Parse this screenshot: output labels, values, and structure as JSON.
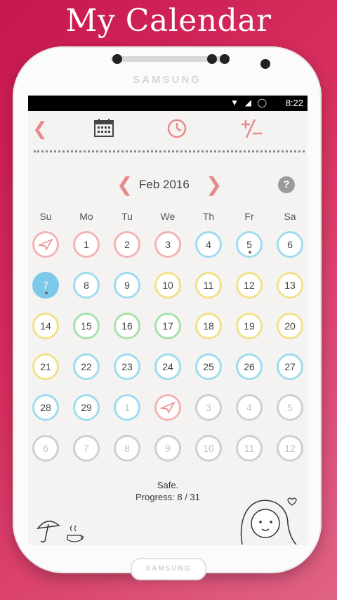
{
  "promo": {
    "title": "My Calendar"
  },
  "device": {
    "brand_top": "SAMSUNG",
    "brand_bottom": "SAMSUNG"
  },
  "status_bar": {
    "time": "8:22"
  },
  "toolbar": {
    "back_icon": "chevron-left-icon",
    "calendar_icon": "calendar-icon",
    "clock_icon": "clock-icon",
    "plusminus_icon": "plus-minus-icon"
  },
  "calendar": {
    "month_label": "Feb 2016",
    "help_label": "?",
    "weekdays": [
      "Su",
      "Mo",
      "Tu",
      "We",
      "Th",
      "Fr",
      "Sa"
    ],
    "rows": [
      [
        {
          "l": "",
          "c": "pink",
          "icon": "plane"
        },
        {
          "l": "1",
          "c": "pink"
        },
        {
          "l": "2",
          "c": "pink"
        },
        {
          "l": "3",
          "c": "pink"
        },
        {
          "l": "4",
          "c": "blue"
        },
        {
          "l": "5",
          "c": "blue",
          "dot": true
        },
        {
          "l": "6",
          "c": "blue"
        }
      ],
      [
        {
          "l": "7",
          "c": "today",
          "dot": true
        },
        {
          "l": "8",
          "c": "blue"
        },
        {
          "l": "9",
          "c": "blue"
        },
        {
          "l": "10",
          "c": "yellow"
        },
        {
          "l": "11",
          "c": "yellow"
        },
        {
          "l": "12",
          "c": "yellow"
        },
        {
          "l": "13",
          "c": "yellow"
        }
      ],
      [
        {
          "l": "14",
          "c": "yellow"
        },
        {
          "l": "15",
          "c": "green"
        },
        {
          "l": "16",
          "c": "green"
        },
        {
          "l": "17",
          "c": "green"
        },
        {
          "l": "18",
          "c": "yellow"
        },
        {
          "l": "19",
          "c": "yellow"
        },
        {
          "l": "20",
          "c": "yellow"
        }
      ],
      [
        {
          "l": "21",
          "c": "yellow"
        },
        {
          "l": "22",
          "c": "blue"
        },
        {
          "l": "23",
          "c": "blue"
        },
        {
          "l": "24",
          "c": "blue"
        },
        {
          "l": "25",
          "c": "blue"
        },
        {
          "l": "26",
          "c": "blue"
        },
        {
          "l": "27",
          "c": "blue"
        }
      ],
      [
        {
          "l": "28",
          "c": "blue"
        },
        {
          "l": "29",
          "c": "blue"
        },
        {
          "l": "1",
          "c": "blue",
          "fade": true
        },
        {
          "l": "",
          "c": "pink",
          "icon": "plane"
        },
        {
          "l": "3",
          "c": "grey",
          "fade": true
        },
        {
          "l": "4",
          "c": "grey",
          "fade": true
        },
        {
          "l": "5",
          "c": "grey",
          "fade": true
        }
      ],
      [
        {
          "l": "6",
          "c": "grey",
          "fade": true
        },
        {
          "l": "7",
          "c": "grey",
          "fade": true
        },
        {
          "l": "8",
          "c": "grey",
          "fade": true
        },
        {
          "l": "9",
          "c": "grey",
          "fade": true
        },
        {
          "l": "10",
          "c": "grey",
          "fade": true
        },
        {
          "l": "11",
          "c": "grey",
          "fade": true
        },
        {
          "l": "12",
          "c": "grey",
          "fade": true
        }
      ]
    ]
  },
  "summary": {
    "status": "Safe.",
    "progress": "Progress: 8 / 31"
  }
}
